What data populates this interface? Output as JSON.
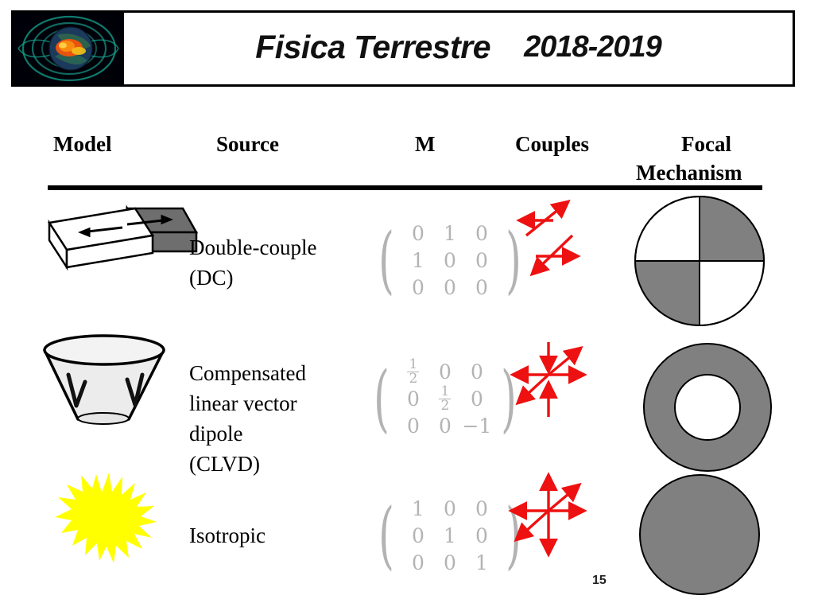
{
  "banner": {
    "logo_icon": "earth-magnetic-field-icon",
    "title": "Fisica Terrestre",
    "year": "2018-2019"
  },
  "table": {
    "headers": {
      "model": "Model",
      "source": "Source",
      "m": "M",
      "couples": "Couples",
      "focal": "Focal",
      "mechanism": "Mechanism"
    },
    "rows": [
      {
        "model_icon": "double-couple-shear-block-icon",
        "source": "Double-couple\n(DC)",
        "source_line1": "Double-couple",
        "source_line2": "(DC)",
        "matrix": [
          [
            "0",
            "1",
            "0"
          ],
          [
            "1",
            "0",
            "0"
          ],
          [
            "0",
            "0",
            "0"
          ]
        ],
        "couples_icon": "double-couple-arrows-icon",
        "focal_icon": "beachball-quadrants-icon"
      },
      {
        "model_icon": "clvd-cone-icon",
        "source": "Compensated linear vector dipole (CLVD)",
        "source_line1": "Compensated",
        "source_line2": "linear vector",
        "source_line3": "dipole",
        "source_line4": "(CLVD)",
        "matrix": [
          [
            "1/2",
            "0",
            "0"
          ],
          [
            "0",
            "1/2",
            "0"
          ],
          [
            "0",
            "0",
            "−1"
          ]
        ],
        "couples_icon": "clvd-arrows-icon",
        "focal_icon": "beachball-annulus-icon"
      },
      {
        "model_icon": "isotropic-explosion-star-icon",
        "source": "Isotropic",
        "source_line1": "Isotropic",
        "matrix": [
          [
            "1",
            "0",
            "0"
          ],
          [
            "0",
            "1",
            "0"
          ],
          [
            "0",
            "0",
            "1"
          ]
        ],
        "couples_icon": "isotropic-arrows-icon",
        "focal_icon": "beachball-full-icon"
      }
    ]
  },
  "page_number": "15",
  "colors": {
    "arrow_red": "#ee1111",
    "beachball_gray": "#808080",
    "matrix_gray": "#b3b3b3",
    "star_yellow": "#ffff00",
    "block_gray": "#6e6e6e"
  }
}
